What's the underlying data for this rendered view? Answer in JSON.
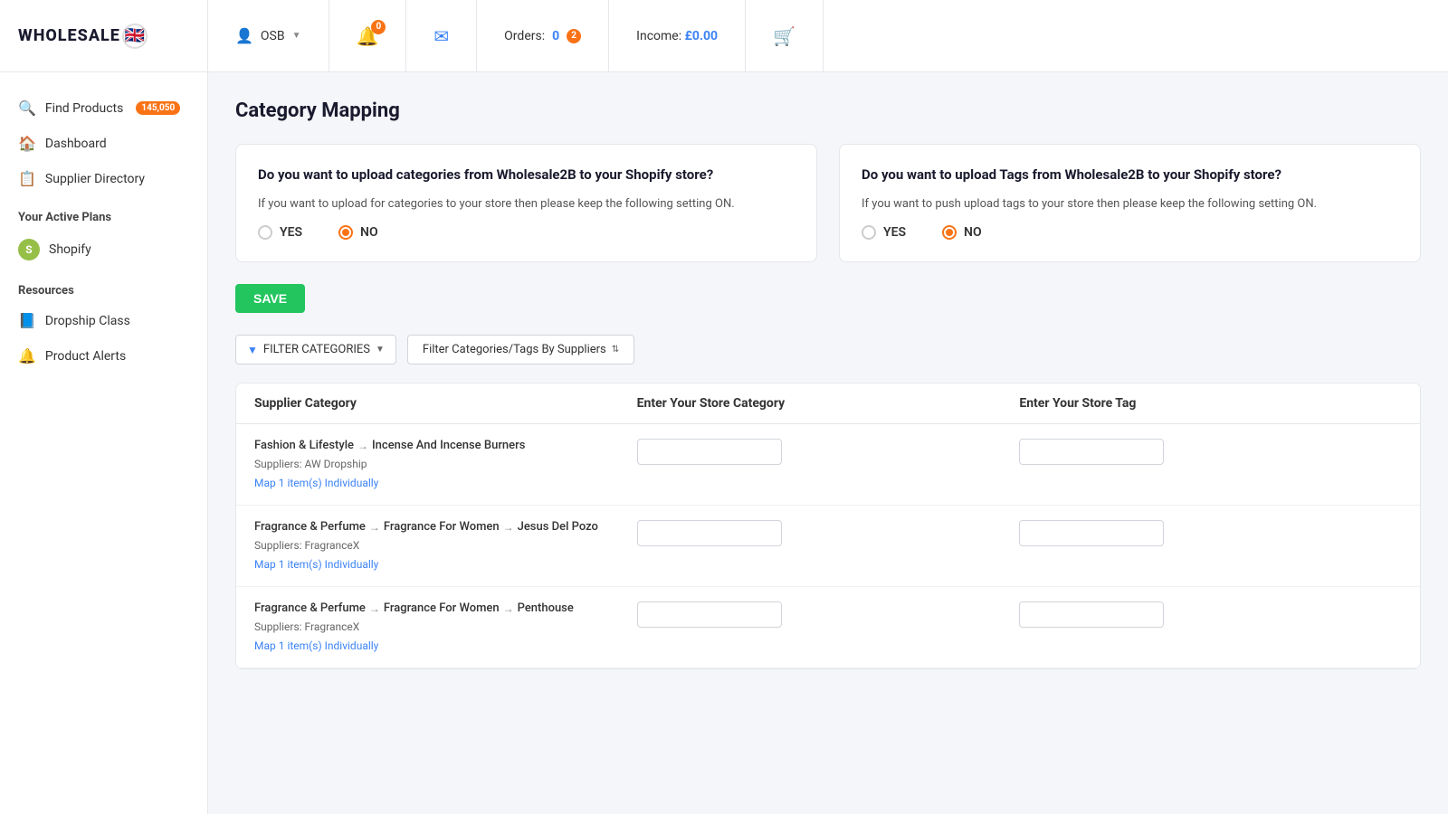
{
  "header": {
    "logo_text": "WHOLESALE",
    "logo_flag": "🇬🇧",
    "user_name": "OSB",
    "bell_badge": "0",
    "orders_badge": "2",
    "orders_label": "Orders:",
    "orders_count": "0",
    "income_label": "Income:",
    "income_value": "£0.00"
  },
  "sidebar": {
    "find_products_label": "Find Products",
    "find_products_badge": "145,050",
    "dashboard_label": "Dashboard",
    "supplier_directory_label": "Supplier Directory",
    "your_active_plans_label": "Your Active Plans",
    "shopify_label": "Shopify",
    "resources_label": "Resources",
    "dropship_class_label": "Dropship Class",
    "product_alerts_label": "Product Alerts"
  },
  "main": {
    "page_title": "Category Mapping",
    "upload_categories_question": "Do you want to upload categories from Wholesale2B to your Shopify store?",
    "upload_categories_hint": "If you want to upload for categories to your store then please keep the following setting ON.",
    "upload_tags_question": "Do you want to upload Tags from Wholesale2B to your Shopify store?",
    "upload_tags_hint": "If you want to push upload tags to your store then please keep the following setting ON.",
    "yes_label": "YES",
    "no_label": "NO",
    "save_label": "SAVE",
    "filter_categories_label": "FILTER CATEGORIES",
    "supplier_filter_label": "Filter Categories/Tags By Suppliers",
    "table_header_supplier": "Supplier Category",
    "table_header_store_cat": "Enter Your Store Category",
    "table_header_store_tag": "Enter Your Store Tag",
    "rows": [
      {
        "cat1": "Fashion & Lifestyle",
        "cat2": "Incense And Incense Burners",
        "cat3": null,
        "suppliers": "AW Dropship",
        "map_text": "Map 1 item(s) Individually"
      },
      {
        "cat1": "Fragrance & Perfume",
        "cat2": "Fragrance For Women",
        "cat3": "Jesus Del Pozo",
        "suppliers": "FragranceX",
        "map_text": "Map 1 item(s) Individually"
      },
      {
        "cat1": "Fragrance & Perfume",
        "cat2": "Fragrance For Women",
        "cat3": "Penthouse",
        "suppliers": "FragranceX",
        "map_text": "Map 1 item(s) Individually"
      }
    ]
  }
}
